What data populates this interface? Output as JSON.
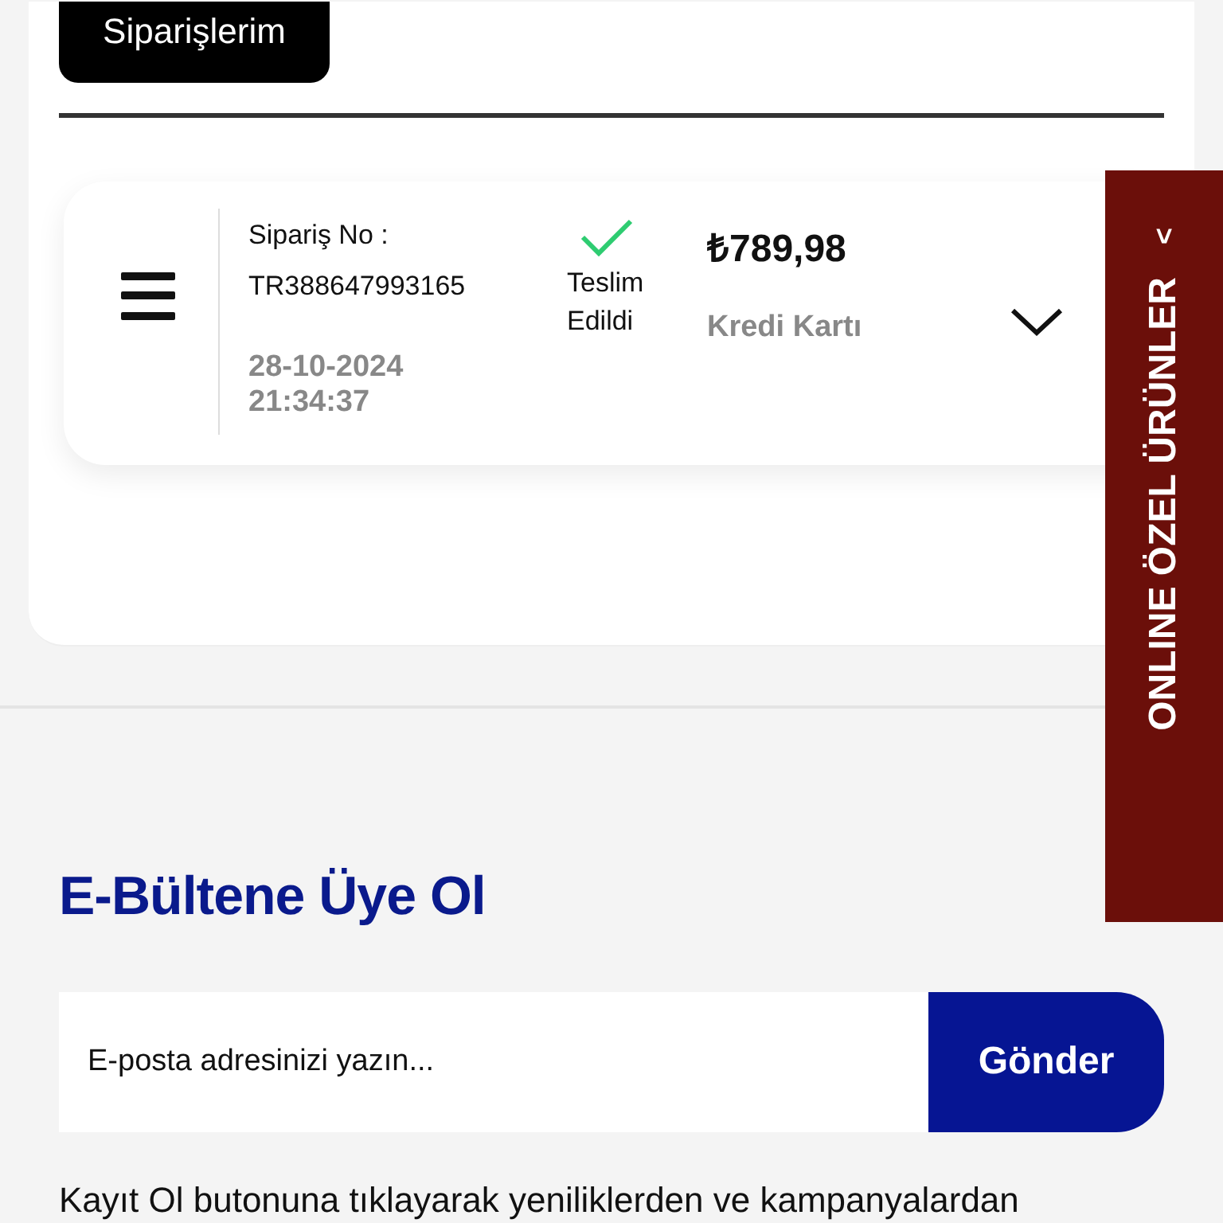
{
  "tab_button": {
    "label": "Siparişlerim"
  },
  "order": {
    "number_label": "Sipariş No :",
    "number": "TR388647993165",
    "date": "28-10-2024",
    "time": "21:34:37",
    "status": "Teslim Edildi",
    "total": "₺789,98",
    "payment": "Kredi Kartı"
  },
  "side_tab": {
    "arrow": "<",
    "label": "ONLINE ÖZEL ÜRÜNLER"
  },
  "newsletter": {
    "title": "E-Bültene Üye Ol",
    "placeholder": "E-posta adresinizi yazın...",
    "button": "Gönder",
    "note": "Kayıt Ol butonuna tıklayarak yeniliklerden ve kampanyalardan"
  }
}
